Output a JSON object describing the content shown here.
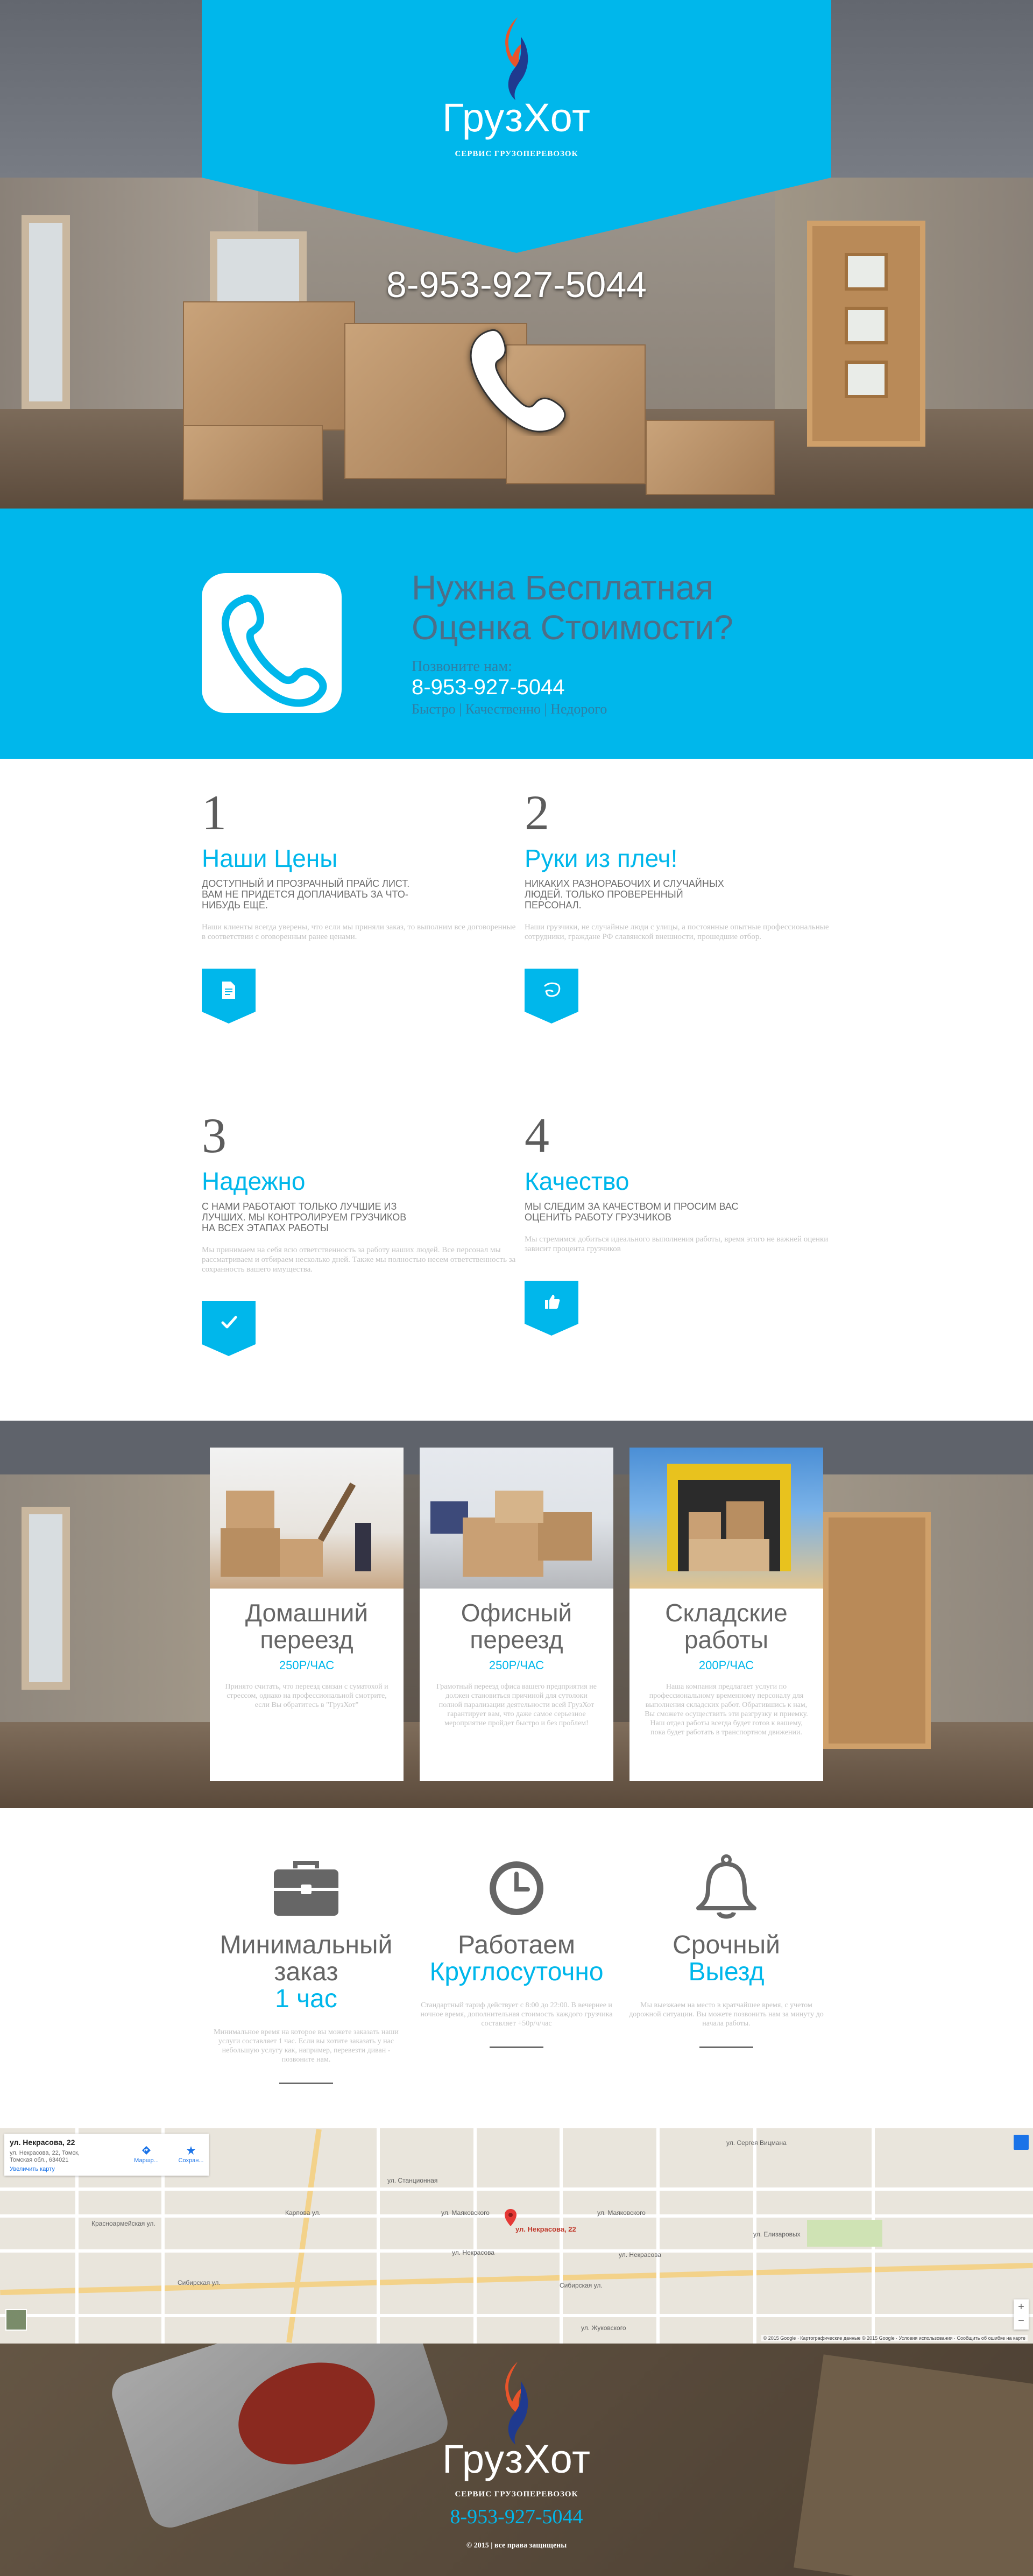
{
  "brand": {
    "name": "ГрузХот",
    "tagline": "СЕРВИС ГРУЗОПЕРЕВОЗОК"
  },
  "hero": {
    "phone": "8-953-927-5044"
  },
  "cta": {
    "title_line1": "Нужна Бесплатная",
    "title_line2": "Оценка Стоимости?",
    "call_label": "Позвоните нам:",
    "phone": "8-953-927-5044",
    "tagline": "Быстро | Качественно | Недорого"
  },
  "features": [
    {
      "number": "1",
      "title": "Наши Цены",
      "caption": "ДОСТУПНЫЙ И ПРОЗРАЧНЫЙ ПРАЙС ЛИСТ. ВАМ НЕ ПРИДЕТСЯ ДОПЛАЧИВАТЬ ЗА ЧТО-НИБУДЬ ЕЩЕ.",
      "text": "Наши клиенты всегда уверены, что если мы приняли заказ, то выполним все договоренные в соответствии с оговоренным ранее ценами.",
      "icon": "document-icon"
    },
    {
      "number": "2",
      "title": "Руки из плеч!",
      "caption": "НИКАКИХ РАЗНОРАБОЧИХ И СЛУЧАЙНЫХ ЛЮДЕЙ. ТОЛЬКО ПРОВЕРЕННЫЙ ПЕРСОНАЛ.",
      "text": "Наши грузчики, не случайные люди с улицы, а постоянные опытные профессиональные сотрудники, граждане РФ славянской внешности, прошедшие отбор.",
      "icon": "hand-icon"
    },
    {
      "number": "3",
      "title": "Надежно",
      "caption": "С НАМИ РАБОТАЮТ ТОЛЬКО ЛУЧШИЕ ИЗ ЛУЧШИХ. МЫ КОНТРОЛИРУЕМ ГРУЗЧИКОВ НА ВСЕХ ЭТАПАХ РАБОТЫ",
      "text": "Мы принимаем на себя всю ответственность за работу наших людей. Все персонал мы рассматриваем и отбираем несколько дней. Также мы полностью несем ответственность за сохранность вашего имущества.",
      "icon": "check-icon"
    },
    {
      "number": "4",
      "title": "Качество",
      "caption": "МЫ СЛЕДИМ ЗА КАЧЕСТВОМ И ПРОСИМ ВАС ОЦЕНИТЬ РАБОТУ ГРУЗЧИКОВ",
      "text": "Мы стремимся добиться идеального выполнения работы, время этого не важней оценки зависит процента грузчиков",
      "icon": "thumbs-up-icon"
    }
  ],
  "services": [
    {
      "title": "Домашний переезд",
      "price": "250Р/ЧАС",
      "text": "Принято считать, что переезд связан с суматохой и стрессом, однако на профессиональной смотрите, если Вы обратитесь в \"ГрузХот\""
    },
    {
      "title": "Офисный переезд",
      "price": "250Р/ЧАС",
      "text": "Грамотный переезд офиса вашего предприятия не должен становиться причиной для сутолоки полной парализации деятельности всей ГрузХот гарантирует вам, что даже самое серьезное мероприятие пройдет быстро и без проблем!"
    },
    {
      "title": "Складские работы",
      "price": "200Р/ЧАС",
      "text": "Наша компания предлагает услуги по профессиональному временному персоналу для выполнения складских работ. Обратившись к нам, Вы сможете осуществить эти разгрузку и приемку. Наш отдел работы всегда будет готов к вашему, пока будет работать в транспортном движении."
    }
  ],
  "info": [
    {
      "line1": "Минимальный заказ",
      "line2": "1 час",
      "text": "Минимальное время на которое вы можете заказать наши услуги составляет 1 час. Если вы хотите заказать у нас небольшую услугу как, например, перевезти диван - позвоните нам.",
      "icon": "briefcase-icon"
    },
    {
      "line1": "Работаем",
      "line2": "Круглосуточно",
      "text": "Стандартный тариф действует с 8:00 до 22:00. В вечернее и ночное время, дополнительная стоимость каждого грузчика составляет +50р/ч/час",
      "icon": "clock-icon"
    },
    {
      "line1": "Срочный",
      "line2": "Выезд",
      "text": "Мы выезжаем на место в кратчайшее время, с учетом дорожной ситуации. Вы можете позвонить нам за минуту до начала работы.",
      "icon": "bell-icon"
    }
  ],
  "map": {
    "address": "ул. Некрасова, 22",
    "address_full": "ул. Некрасова, 22, Томск, Томская обл., 634021",
    "enlarge": "Увеличить карту",
    "route": "Маршр...",
    "save": "Сохран...",
    "pin_label": "ул. Некрасова, 22",
    "copyright": "© 2015 Google · Картографические данные © 2015 Google · Условия использования · Сообщить об ошибке на карте",
    "streets": [
      "ул. Некрасова",
      "Сибирская ул.",
      "ул. Маяковского",
      "ул. Сергея Вицмана",
      "ул. Жуковского",
      "ул. Елизаровых",
      "Карпова ул.",
      "ул. Станционная",
      "Красноармейская ул."
    ]
  },
  "footer": {
    "phone": "8-953-927-5044",
    "copyright": "© 2015 | все права защищены"
  },
  "colors": {
    "accent": "#00b7eb",
    "text": "#666666",
    "muted": "#c2c2c2"
  }
}
